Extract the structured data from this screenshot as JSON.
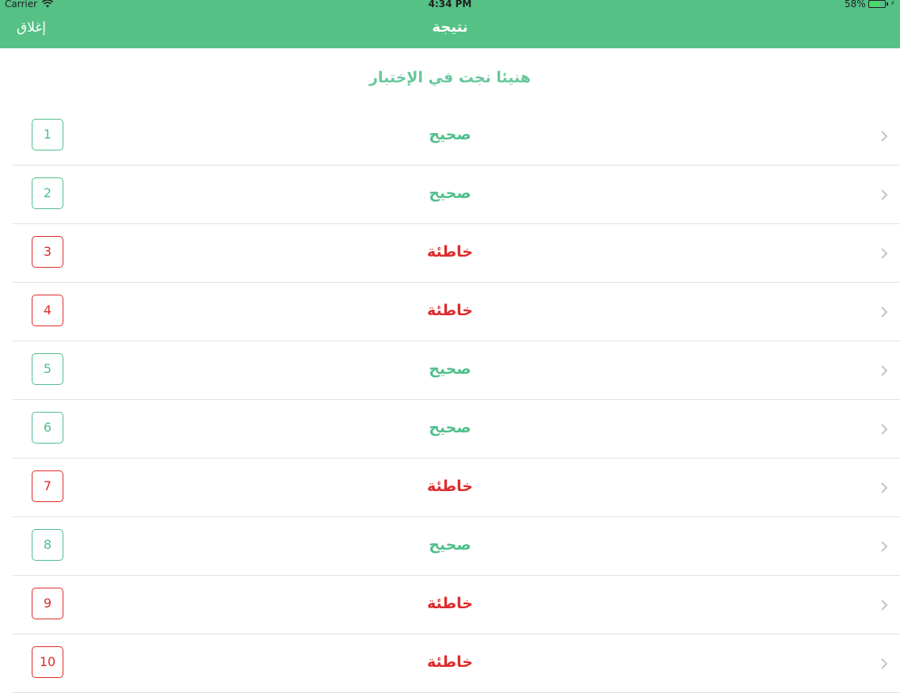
{
  "status_bar": {
    "carrier": "Carrier",
    "time": "4:34 PM",
    "battery": "58%"
  },
  "nav": {
    "title": "نتيجة",
    "close_label": "إغلاق"
  },
  "headline": "هنيئا نجت في الإختبار",
  "colors": {
    "brand": "#55c185",
    "correct": "#4fbf8b",
    "wrong": "#dd2b2b"
  },
  "results": [
    {
      "number": "1",
      "label": "صحيح",
      "status": "correct"
    },
    {
      "number": "2",
      "label": "صحيح",
      "status": "correct"
    },
    {
      "number": "3",
      "label": "خاطئة",
      "status": "wrong"
    },
    {
      "number": "4",
      "label": "خاطئة",
      "status": "wrong"
    },
    {
      "number": "5",
      "label": "صحيح",
      "status": "correct"
    },
    {
      "number": "6",
      "label": "صحيح",
      "status": "correct"
    },
    {
      "number": "7",
      "label": "خاطئة",
      "status": "wrong"
    },
    {
      "number": "8",
      "label": "صحيح",
      "status": "correct"
    },
    {
      "number": "9",
      "label": "خاطئة",
      "status": "wrong"
    },
    {
      "number": "10",
      "label": "خاطئة",
      "status": "wrong"
    }
  ]
}
